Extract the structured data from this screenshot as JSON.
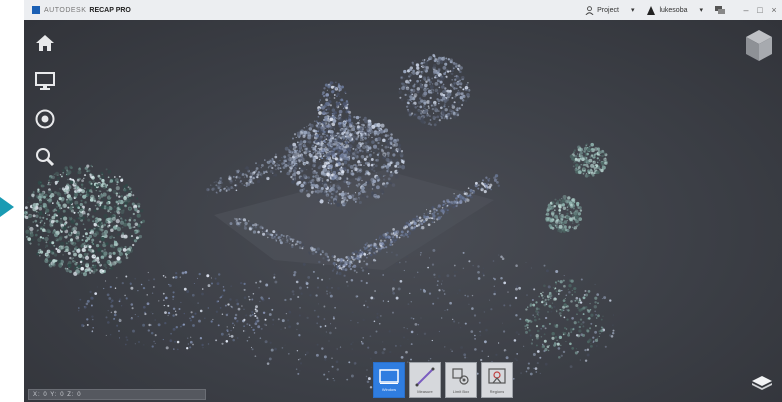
{
  "titlebar": {
    "brand": "AUTODESK",
    "product": "RECAP PRO",
    "project_menu": "Project",
    "user_menu": "lukesoba",
    "icons": [
      "person-icon",
      "chevron-down-icon",
      "user-icon",
      "chevron-down-icon",
      "chat-icon",
      "minimize-icon",
      "maximize-icon",
      "close-icon"
    ]
  },
  "nav_tools": [
    "home-icon",
    "display-icon",
    "orbit-icon",
    "zoom-icon"
  ],
  "bottom_toolbar": {
    "tools": [
      {
        "name": "window-select-tool",
        "label": "Window",
        "active": true
      },
      {
        "name": "measure-tool",
        "label": "Measure",
        "active": false
      },
      {
        "name": "limit-box-tool",
        "label": "Limit Box",
        "active": false
      },
      {
        "name": "region-tool",
        "label": "Regions",
        "active": false
      }
    ]
  },
  "status_bar": {
    "text": "X: 0   Y: 0   Z: 0"
  },
  "colors": {
    "viewport": "#3e4148",
    "accent": "#2f7de0",
    "arrow": "#1a9bb3"
  }
}
